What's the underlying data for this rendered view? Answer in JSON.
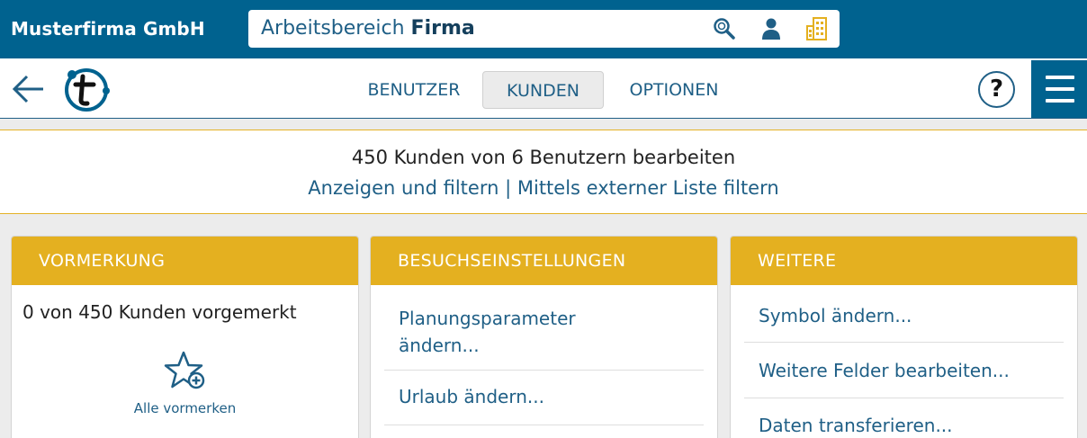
{
  "header": {
    "company": "Musterfirma GmbH",
    "workspace_prefix": "Arbeitsbereich",
    "workspace_name": "Firma",
    "icons": [
      "search-icon",
      "user-icon",
      "building-icon"
    ]
  },
  "nav": {
    "tabs": [
      {
        "label": "BENUTZER",
        "active": false
      },
      {
        "label": "KUNDEN",
        "active": true
      },
      {
        "label": "OPTIONEN",
        "active": false
      }
    ],
    "help_label": "?"
  },
  "summary": {
    "title": "450 Kunden von 6 Benutzern bearbeiten",
    "link1": "Anzeigen und filtern",
    "separator": "|",
    "link2": "Mittels externer Liste filtern"
  },
  "cards": {
    "vormerkung": {
      "title": "VORMERKUNG",
      "status": "0 von 450 Kunden vorgemerkt",
      "action": "Alle vormerken"
    },
    "besuch": {
      "title": "BESUCHSEINSTELLUNGEN",
      "items": [
        "Planungsparameter ändern...",
        "Urlaub ändern..."
      ]
    },
    "weitere": {
      "title": "WEITERE",
      "items": [
        "Symbol ändern...",
        "Weitere Felder bearbeiten...",
        "Daten transferieren..."
      ]
    }
  },
  "colors": {
    "brand_blue": "#00628f",
    "accent_yellow": "#e4b020",
    "link_blue": "#1f5f86"
  }
}
